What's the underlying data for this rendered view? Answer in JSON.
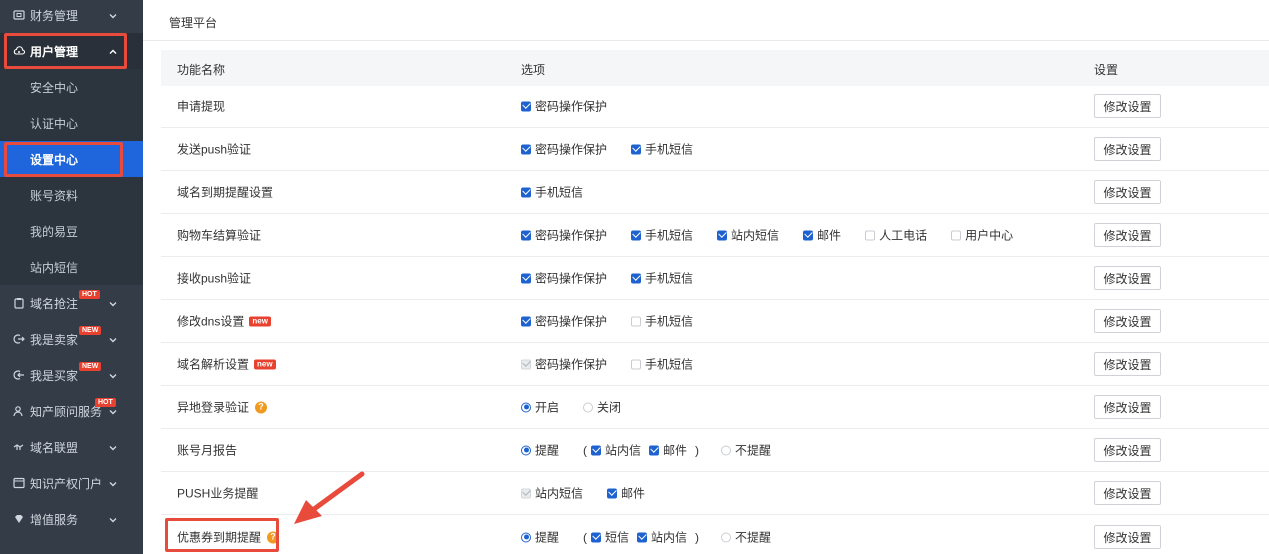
{
  "sidebar": {
    "items": [
      {
        "label": "财务管理",
        "icon": "wallet-icon"
      },
      {
        "label": "用户管理",
        "icon": "cloud-user-icon"
      },
      {
        "label": "域名抢注",
        "icon": "clipboard-icon",
        "badge": "HOT"
      },
      {
        "label": "我是卖家",
        "icon": "exit-icon",
        "badge": "NEW"
      },
      {
        "label": "我是买家",
        "icon": "enter-icon",
        "badge": "NEW"
      },
      {
        "label": "知产顾问服务",
        "icon": "person-icon",
        "badge": "HOT"
      },
      {
        "label": "域名联盟",
        "icon": "handshake-icon"
      },
      {
        "label": "知识产权门户",
        "icon": "portal-icon"
      },
      {
        "label": "增值服务",
        "icon": "diamond-icon"
      }
    ],
    "sub_items": [
      "安全中心",
      "认证中心",
      "设置中心",
      "账号资料",
      "我的易豆",
      "站内短信"
    ]
  },
  "main": {
    "title": "管理平台",
    "headers": {
      "name": "功能名称",
      "options": "选项",
      "settings": "设置"
    },
    "button_label": "修改设置",
    "rows": [
      {
        "name": "申请提现"
      },
      {
        "name": "发送push验证"
      },
      {
        "name": "域名到期提醒设置"
      },
      {
        "name": "购物车结算验证"
      },
      {
        "name": "接收push验证"
      },
      {
        "name": "修改dns设置",
        "tag": "new"
      },
      {
        "name": "域名解析设置",
        "tag": "new"
      },
      {
        "name": "异地登录验证",
        "help": "?"
      },
      {
        "name": "账号月报告"
      },
      {
        "name": "PUSH业务提醒"
      },
      {
        "name": "优惠券到期提醒",
        "help": "?"
      }
    ],
    "options": {
      "password_protect": "密码操作保护",
      "sms": "手机短信",
      "site_msg": "站内短信",
      "site_letter": "站内信",
      "email": "邮件",
      "manual_call": "人工电话",
      "user_center": "用户中心",
      "on": "开启",
      "off": "关闭",
      "remind": "提醒",
      "no_remind": "不提醒",
      "short_msg": "短信",
      "paren_open": "(",
      "paren_close": ")"
    }
  },
  "colors": {
    "sidebar_bg": "#333c47",
    "active_blue": "#1f66dd",
    "highlight_red": "#e84a3c",
    "checkbox_blue": "#1e62d0"
  }
}
